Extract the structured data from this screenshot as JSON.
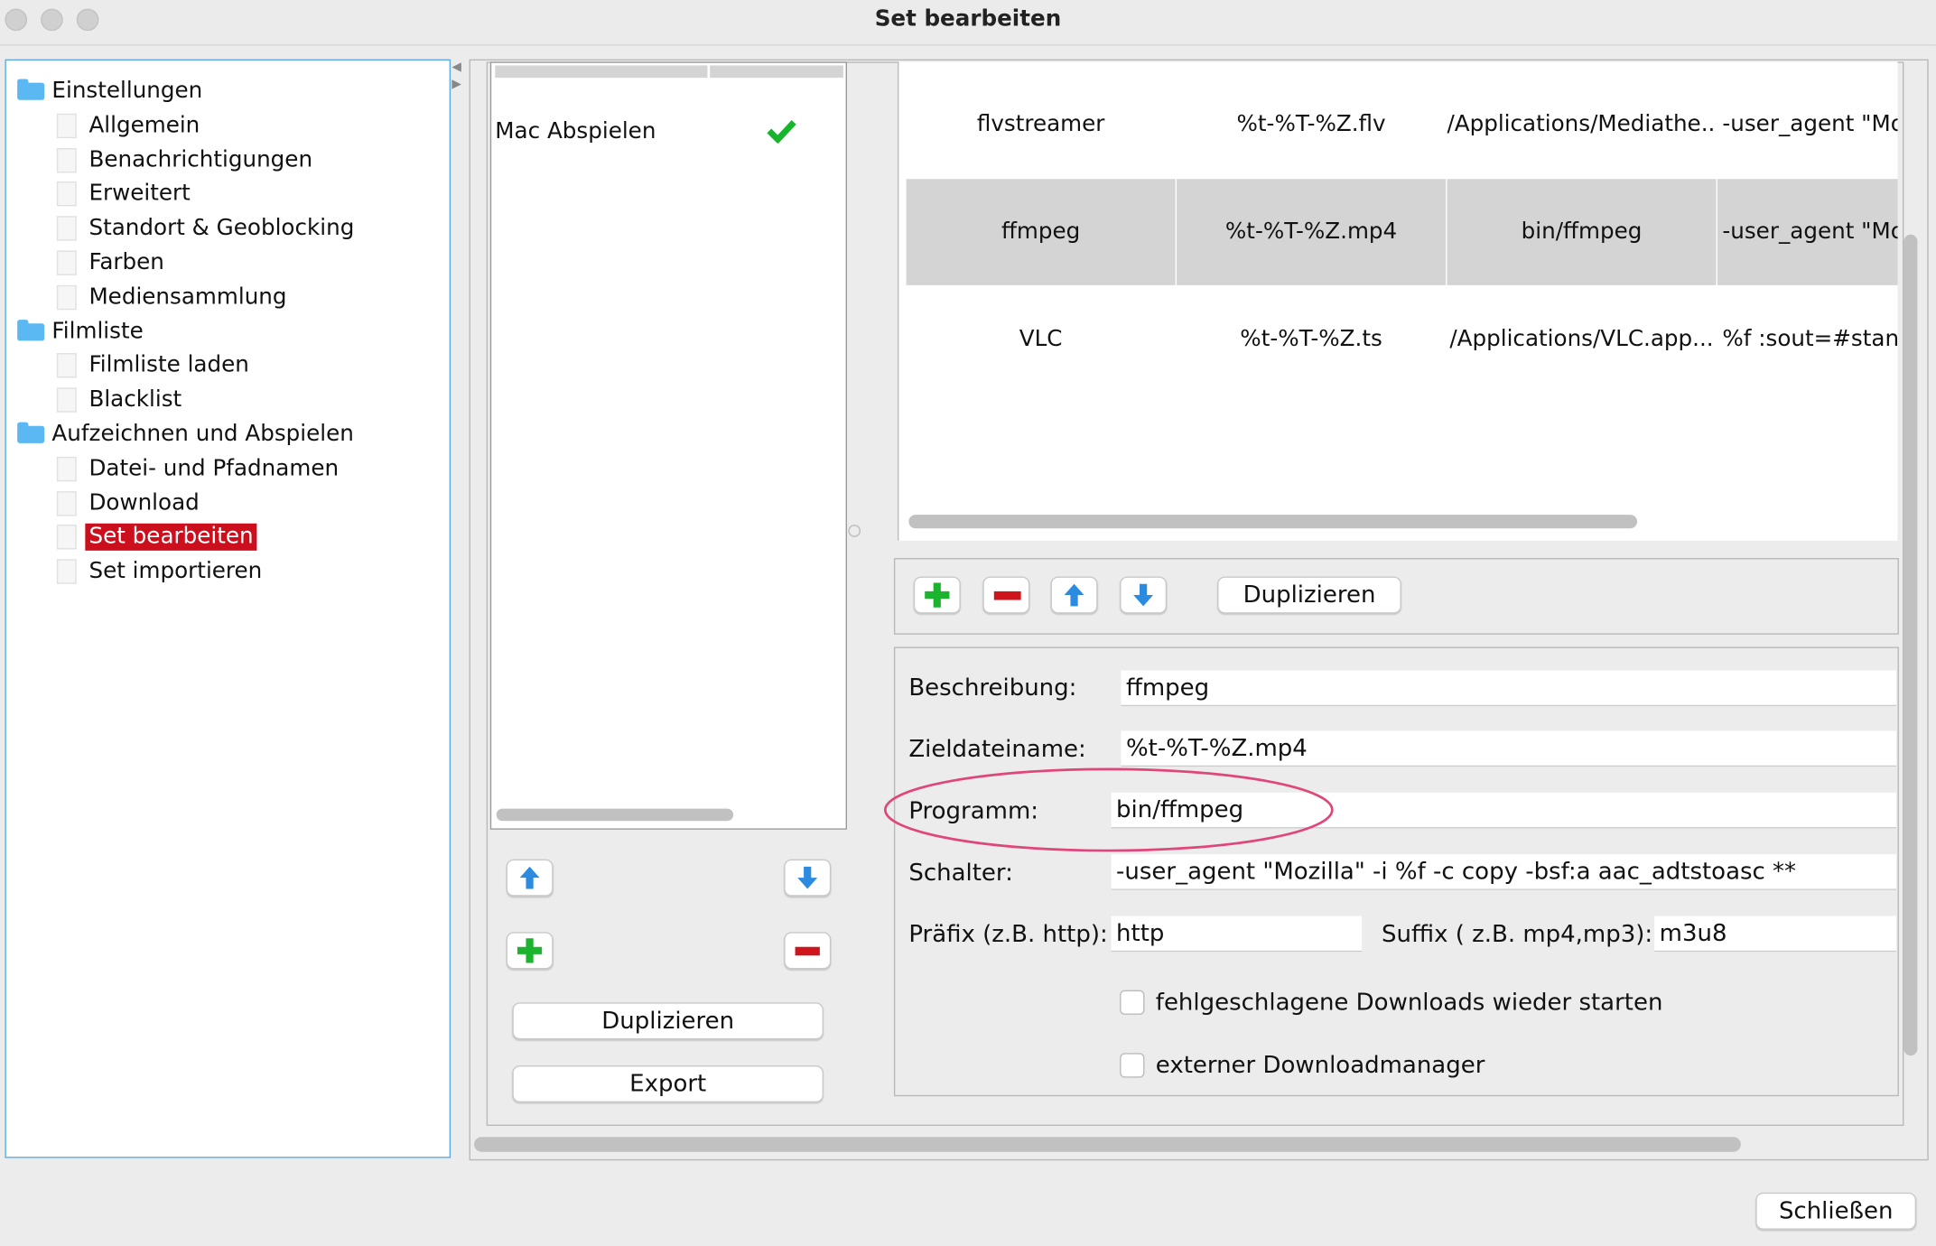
{
  "window": {
    "title": "Set bearbeiten"
  },
  "tree": {
    "items": [
      {
        "label": "Einstellungen",
        "type": "folder"
      },
      {
        "label": "Allgemein",
        "type": "page"
      },
      {
        "label": "Benachrichtigungen",
        "type": "page"
      },
      {
        "label": "Erweitert",
        "type": "page"
      },
      {
        "label": "Standort & Geoblocking",
        "type": "page"
      },
      {
        "label": "Farben",
        "type": "page"
      },
      {
        "label": "Mediensammlung",
        "type": "page"
      },
      {
        "label": "Filmliste",
        "type": "folder"
      },
      {
        "label": "Filmliste laden",
        "type": "page"
      },
      {
        "label": "Blacklist",
        "type": "page"
      },
      {
        "label": "Aufzeichnen und Abspielen",
        "type": "folder"
      },
      {
        "label": "Datei- und Pfadnamen",
        "type": "page"
      },
      {
        "label": "Download",
        "type": "page"
      },
      {
        "label": "Set bearbeiten",
        "type": "page",
        "selected": true
      },
      {
        "label": "Set importieren",
        "type": "page"
      }
    ],
    "selected_color": "#cc0f1d"
  },
  "sets": {
    "rows": [
      {
        "name": "Mac Abspielen",
        "active_icon": "check-icon"
      }
    ],
    "duplicate_label": "Duplizieren",
    "export_label": "Export"
  },
  "programs": {
    "rows": [
      [
        "flvstreamer",
        "%t-%T-%Z.flv",
        "/Applications/Mediathe...",
        "-user_agent \"Moz"
      ],
      [
        "ffmpeg",
        "%t-%T-%Z.mp4",
        "bin/ffmpeg",
        "-user_agent \"Moz"
      ],
      [
        "VLC",
        "%t-%T-%Z.ts",
        "/Applications/VLC.app...",
        "%f :sout=#standa"
      ]
    ],
    "selected_row": 1,
    "duplicate_label": "Duplizieren"
  },
  "form": {
    "beschreibung_label": "Beschreibung:",
    "beschreibung": "ffmpeg",
    "ziel_label": "Zieldateiname:",
    "ziel": "%t-%T-%Z.mp4",
    "programm_label": "Programm:",
    "programm": "bin/ffmpeg",
    "schalter_label": "Schalter:",
    "schalter": "-user_agent \"Mozilla\" -i %f -c copy -bsf:a aac_adtstoasc **",
    "praefix_label": "Präfix (z.B. http):",
    "praefix": "http",
    "suffix_label": "Suffix ( z.B. mp4,mp3):",
    "suffix": "m3u8",
    "restart_label": "fehlgeschlagene Downloads wieder starten",
    "restart_checked": false,
    "external_label": "externer Downloadmanager",
    "external_checked": false,
    "highlight_color": "#e0457b"
  },
  "footer": {
    "close_label": "Schließen"
  }
}
